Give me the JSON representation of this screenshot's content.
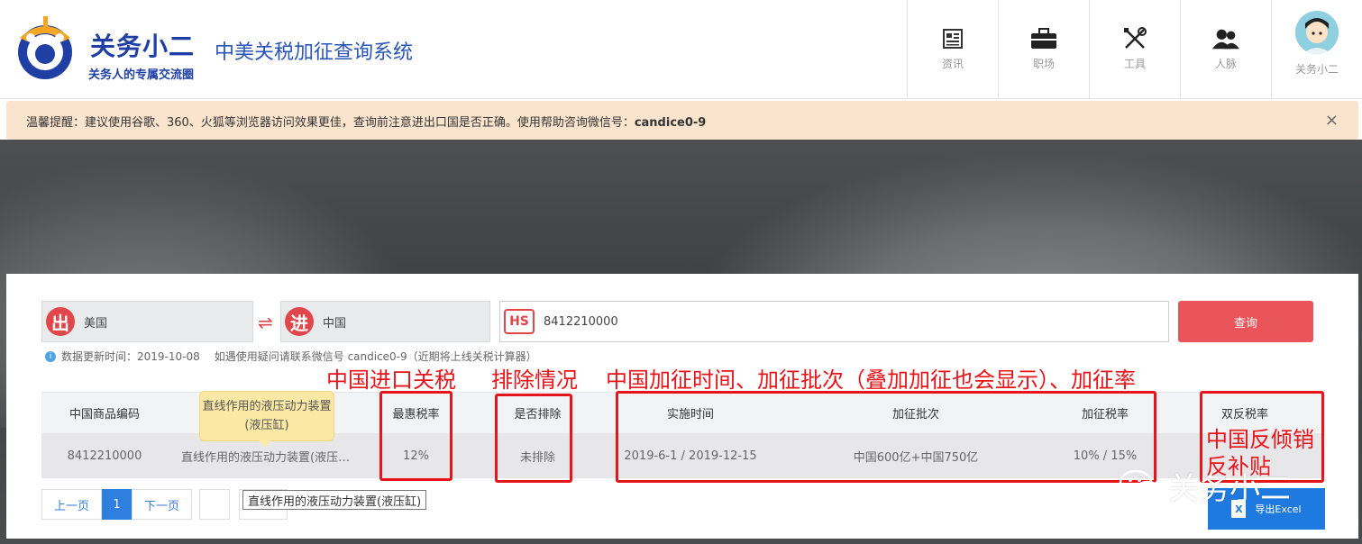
{
  "header": {
    "brand_name": "关务小二",
    "brand_slogan": "关务人的专属交流圈",
    "system_title": "中美关税加征查询系统",
    "nav": [
      {
        "label": "资讯",
        "icon": "news-icon"
      },
      {
        "label": "职场",
        "icon": "briefcase-icon"
      },
      {
        "label": "工具",
        "icon": "tools-icon"
      },
      {
        "label": "人脉",
        "icon": "people-icon"
      },
      {
        "label": "关务小二",
        "icon": "avatar-icon"
      }
    ]
  },
  "notice": {
    "text": "温馨提醒：建议使用谷歌、360、火狐等浏览器访问效果更佳，查询前注意进出口国是否正确。使用帮助咨询微信号：",
    "wechat": "candice0-9",
    "close": "×"
  },
  "search": {
    "from_badge": "出",
    "from_value": "美国",
    "swap": "⇌",
    "to_badge": "进",
    "to_value": "中国",
    "hs_badge": "HS",
    "hs_value": "8412210000",
    "query_button": "查询"
  },
  "info": {
    "update_text": "数据更新时间：2019-10-08",
    "contact_text": "如遇使用疑问请联系微信号 candice0-9（近期将上线关税计算器）"
  },
  "table": {
    "headers": {
      "code": "中国商品编码",
      "rate": "最惠税率",
      "excluded": "是否排除",
      "date": "实施时间",
      "batch": "加征批次",
      "add_rate": "加征税率",
      "anti": "双反税率"
    },
    "row": {
      "code": "8412210000",
      "name": "直线作用的液压动力装置(液压缸)",
      "rate": "12%",
      "excluded": "未排除",
      "date": "2019-6-1 / 2019-12-15",
      "batch": "中国600亿+中国750亿",
      "add_rate": "10% / 15%"
    },
    "tooltip": "直线作用的液压动力装置(液压缸)"
  },
  "pager": {
    "prev": "上一页",
    "current": "1",
    "next": "下一页",
    "tip": "直线作用的液压动力装置(液压缸)"
  },
  "export": {
    "label": "导出Excel",
    "icon_letter": "X"
  },
  "annotations": {
    "import_tax": "中国进口关税",
    "exclusion": "排除情况",
    "add_info": "中国加征时间、加征批次（叠加加征也会显示）、加征率",
    "anti_line1": "中国反倾销",
    "anti_line2": "反补贴"
  },
  "watermark": "关务小二",
  "colors": {
    "brand": "#1f3fa5",
    "accent_red": "#e0464a",
    "notice_bg": "#fbe4cd",
    "export_blue": "#1f7ae0"
  }
}
